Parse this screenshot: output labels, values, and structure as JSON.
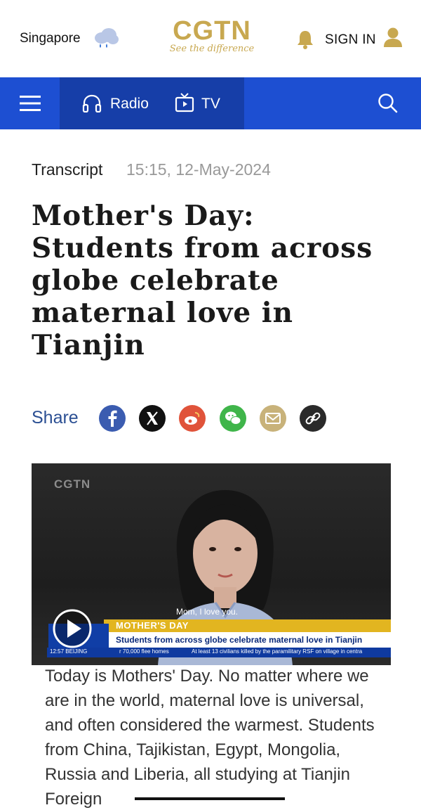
{
  "header": {
    "location": "Singapore",
    "logo_main": "CGTN",
    "logo_tagline": "See the difference",
    "signin_label": "SIGN IN"
  },
  "nav": {
    "radio_label": "Radio",
    "tv_label": "TV"
  },
  "article": {
    "category": "Transcript",
    "timestamp": "15:15, 12-May-2024",
    "headline": "Mother's Day: Students from across globe celebrate maternal love in Tianjin",
    "share_label": "Share",
    "body": "Today is Mothers' Day. No matter where we are in the world, maternal love is universal, and often considered the warmest. Students from China, Tajikistan, Egypt, Mongolia, Russia and Liberia, all studying at Tianjin Foreign"
  },
  "video": {
    "watermark": "CGTN",
    "caption": "Mom, I love you.",
    "lower_third_title": "MOTHER'S DAY",
    "lower_third_subtitle": "Students from across globe celebrate maternal love in Tianjin",
    "ticker_time": "12:57 BEIJING",
    "ticker_item_1": "r 70,000 flee homes",
    "ticker_item_2": "At least 13 civilians killed by the paramilitary RSF on village in centra"
  },
  "colors": {
    "brand_gold": "#c8a850",
    "nav_blue": "#1d4fd2",
    "nav_active": "#163ea8"
  },
  "icons": [
    "weather-icon",
    "bell-icon",
    "user-icon",
    "menu-icon",
    "headphones-icon",
    "tv-icon",
    "search-icon",
    "facebook-icon",
    "x-icon",
    "weibo-icon",
    "wechat-icon",
    "email-icon",
    "link-icon",
    "play-icon"
  ]
}
